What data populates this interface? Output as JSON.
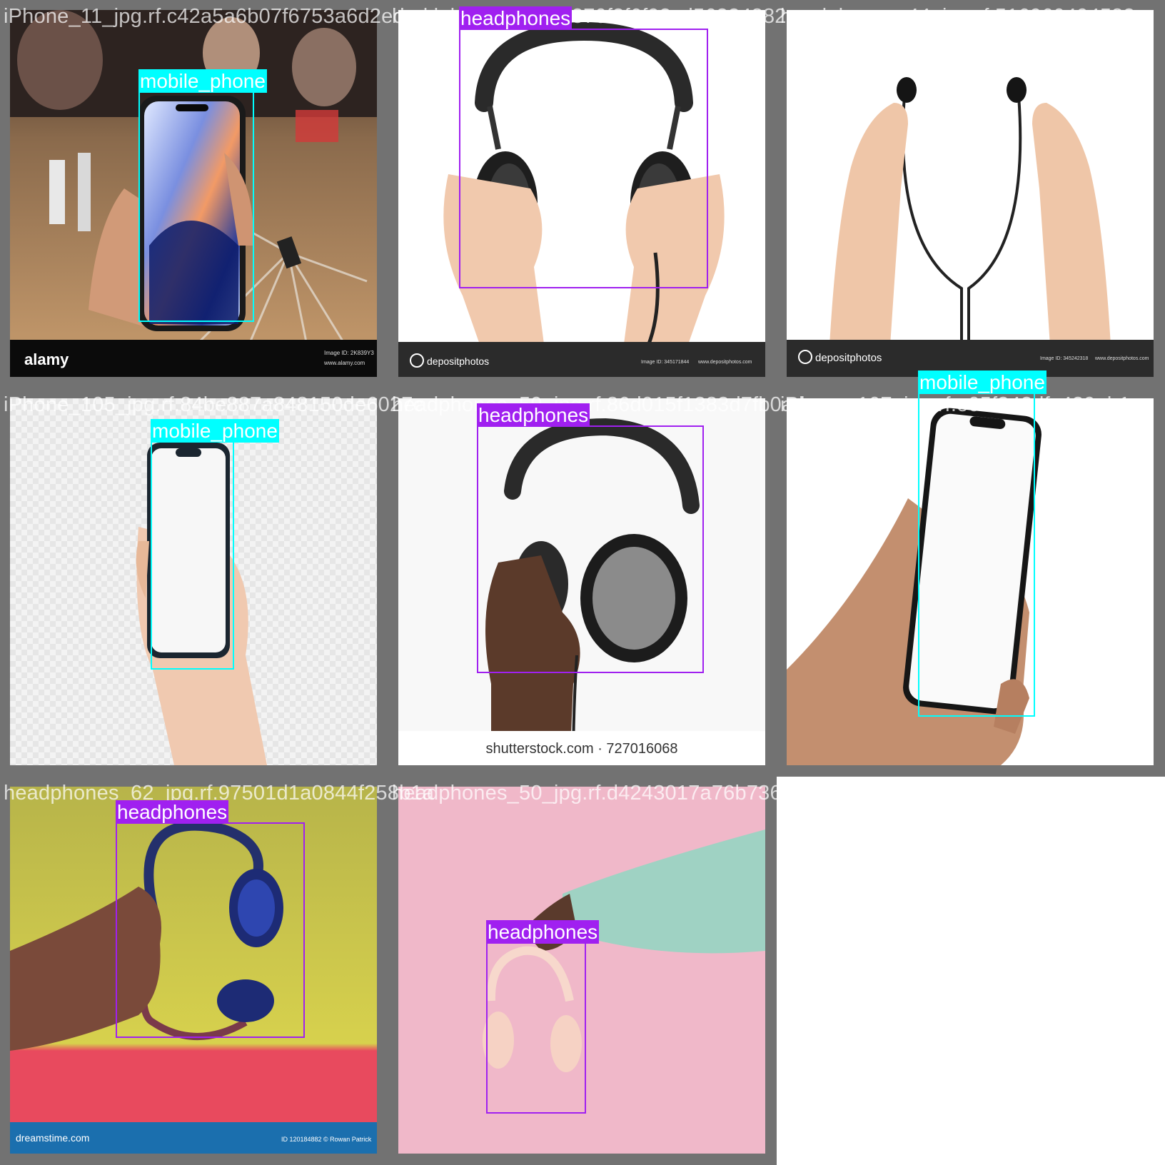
{
  "colors": {
    "grid_gap": "#727272",
    "mobile_phone": "#00FFFF",
    "headphones": "#A020F0"
  },
  "cells": [
    {
      "filename": "iPhone_11_jpg.rf.c42a5a6b07f6753a6d2edad",
      "labels": [
        "mobile_phone"
      ],
      "watermark": {
        "brand": "alamy",
        "ref": "Image ID: 2K839Y3",
        "url": "www.alamy.com"
      }
    },
    {
      "filename": "headphones_jpg.rf.370f3f6f92cd56324882",
      "labels": [
        "headphones"
      ],
      "watermark": {
        "brand": "depositphotos",
        "ref": "Image ID: 345171844",
        "url": "www.depositphotos.com"
      }
    },
    {
      "filename": "headphones_44_jpg.rf.516960494583",
      "labels": [],
      "watermark": {
        "brand": "depositphotos",
        "ref": "Image ID: 345242318",
        "url": "www.depositphotos.com"
      }
    },
    {
      "filename": "iPhone_105_jpg.rf.84be887a848150de6027c",
      "labels": [
        "mobile_phone"
      ]
    },
    {
      "filename": "headphones_59_jpg.rf.86d015f1383d7fb0ad",
      "labels": [
        "headphones"
      ],
      "watermark": {
        "brand": "shutterstock.com · 727016068"
      }
    },
    {
      "filename": "iPhone_107_jpg.rf.e05f343dfc429eb1",
      "labels": [
        "mobile_phone"
      ]
    },
    {
      "filename": "headphones_62_jpg.rf.97501d1a0844f258b1a",
      "labels": [
        "headphones"
      ],
      "watermark": {
        "brand": "dreamstime.com",
        "ref": "ID 120184882 © Rowan Patrick"
      }
    },
    {
      "filename": "headphones_50_jpg.rf.d4243017a76b736fcc0",
      "labels": [
        "headphones"
      ]
    }
  ]
}
